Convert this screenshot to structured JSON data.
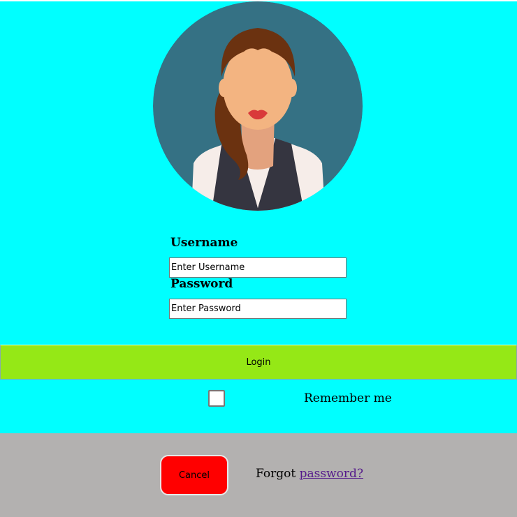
{
  "colors": {
    "top_background": "#00ffff",
    "bottom_background": "#b3b1b0",
    "login_button": "#95e816",
    "cancel_button": "#ff0000",
    "avatar_background": "#357184",
    "link": "#551a8b"
  },
  "avatar": {
    "icon": "woman-avatar-icon"
  },
  "form": {
    "username_label": "Username",
    "username_placeholder": "Enter Username",
    "password_label": "Password",
    "password_placeholder": "Enter Password",
    "login_label": "Login",
    "remember_label": "Remember me",
    "remember_checked": false
  },
  "footer": {
    "cancel_label": "Cancel",
    "forgot_text": "Forgot",
    "forgot_link": "password?"
  }
}
